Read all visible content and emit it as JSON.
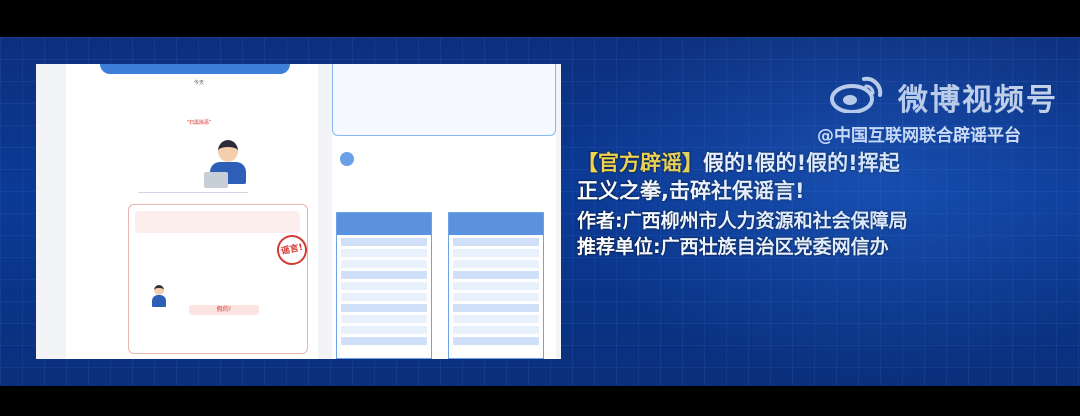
{
  "watermark": {
    "brand": "微博视频号",
    "handle": "@中国互联网联合辟谣平台"
  },
  "headline": {
    "tag": "【官方辟谣】",
    "line1_rest": "假的!假的!假的!挥起",
    "line2": "正义之拳,击碎社保谣言!"
  },
  "author_line": "作者:广西柳州市人力资源和社会保障局",
  "recommender_line": "推荐单位:广西壮族自治区党委网信办",
  "screenshot": {
    "stamp": "谣言!",
    "fake_label": "假的!",
    "text_first": "今天",
    "text_red": "\"扫黑除恶\""
  },
  "colors": {
    "accent_yellow": "#f5d64a",
    "stage_blue": "#0b3a96",
    "panel_blue": "#5a92e0",
    "stamp_red": "#d33a34"
  }
}
